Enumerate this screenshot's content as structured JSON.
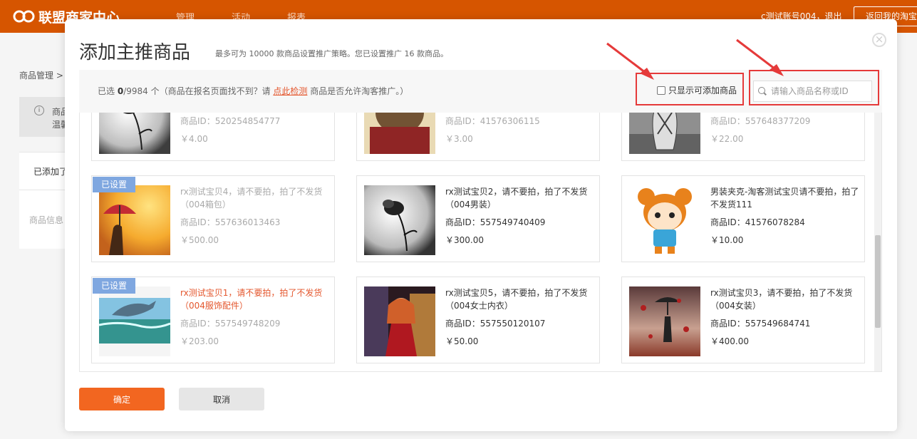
{
  "header": {
    "brand": "联盟商家中心",
    "nav": [
      "管理",
      "活动",
      "报表"
    ],
    "account": "c测试账号004，退出",
    "back_label": "返回我的淘宝"
  },
  "background": {
    "breadcrumb": "商品管理 >",
    "notice_line1": "商品",
    "notice_line2": "温馨",
    "panel_line1": "已添加了",
    "panel_line2": "商品信息"
  },
  "modal": {
    "title": "添加主推商品",
    "subtitle": "最多可为 10000 款商品设置推广策略。您已设置推广 16 款商品。",
    "close": "×",
    "filter": {
      "selected_prefix": "已选 ",
      "selected_count": "0",
      "selected_total": "/9984 个",
      "selected_middle": "（商品在报名页面找不到？请 ",
      "check_link": "点此检测",
      "selected_suffix": " 商品是否允许淘客推广。）",
      "only_addable_label": "只显示可添加商品",
      "search_placeholder": "请输入商品名称或ID"
    },
    "confirm_label": "确定",
    "cancel_label": "取消"
  },
  "products": [
    {
      "name": "",
      "id": "商品ID：520254854777",
      "price": "￥4.00",
      "badge": "",
      "disabled": true,
      "image": "flower-icon"
    },
    {
      "name": "",
      "id": "商品ID：41576306115",
      "price": "￥3.00",
      "badge": "",
      "disabled": true,
      "image": "teddy-bear-icon"
    },
    {
      "name": "",
      "id": "商品ID：557648377209",
      "price": "￥22.00",
      "badge": "",
      "disabled": true,
      "image": "vase-icon"
    },
    {
      "name": "rx测试宝贝4，请不要拍，拍了不发货（004箱包）",
      "id": "商品ID：557636013463",
      "price": "￥500.00",
      "badge": "已设置",
      "disabled": true,
      "image": "umbrella-icon"
    },
    {
      "name": "rx测试宝贝2，请不要拍，拍了不发货（004男装）",
      "id": "商品ID：557549740409",
      "price": "￥300.00",
      "badge": "",
      "disabled": false,
      "image": "flower-icon"
    },
    {
      "name": "男装夹克-淘客测试宝贝请不要拍，拍了不发货111",
      "id": "商品ID：41576078284",
      "price": "￥10.00",
      "badge": "",
      "disabled": false,
      "image": "cartoon-girl-icon"
    },
    {
      "name": "rx测试宝贝1，请不要拍，拍了不发货（004服饰配件）",
      "id": "商品ID：557549748209",
      "price": "￥203.00",
      "badge": "已设置",
      "disabled": true,
      "highlight": true,
      "image": "dolphin-icon"
    },
    {
      "name": "rx测试宝贝5，请不要拍，拍了不发货（004女士内衣）",
      "id": "商品ID：557550120107",
      "price": "￥50.00",
      "badge": "",
      "disabled": false,
      "image": "anime-girl-icon"
    },
    {
      "name": "rx测试宝贝3，请不要拍，拍了不发货（004女装）",
      "id": "商品ID：557549684741",
      "price": "￥400.00",
      "badge": "",
      "disabled": false,
      "image": "umbrella-leaves-icon"
    }
  ],
  "colors": {
    "header": "#d65500",
    "accent": "#f26620",
    "badge": "#7fa7e0",
    "highlight_annotation": "#e53a3a"
  }
}
